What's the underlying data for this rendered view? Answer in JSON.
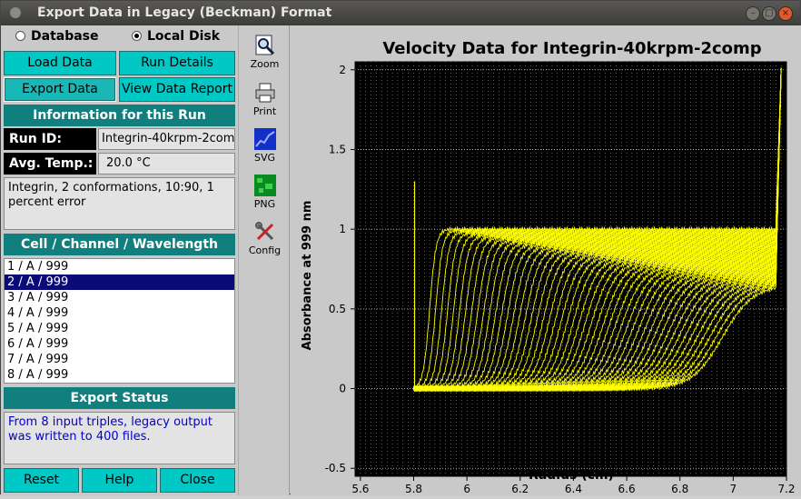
{
  "window": {
    "title": "Export Data in Legacy (Beckman) Format"
  },
  "source": {
    "options": [
      "Database",
      "Local Disk"
    ],
    "selected": "Local Disk"
  },
  "buttons": {
    "load_data": "Load Data",
    "run_details": "Run Details",
    "export_data": "Export Data",
    "view_report": "View Data Report",
    "reset": "Reset",
    "help": "Help",
    "close": "Close"
  },
  "run_info": {
    "header": "Information for this Run",
    "run_id_label": "Run ID:",
    "run_id": "Integrin-40krpm-2comp",
    "temp_label": "Avg. Temp.:",
    "temp": "20.0 °C",
    "description": "Integrin, 2 conformations, 10:90, 1 percent error"
  },
  "triples": {
    "header": "Cell / Channel / Wavelength",
    "items": [
      "1 / A / 999",
      "2 / A / 999",
      "3 / A / 999",
      "4 / A / 999",
      "5 / A / 999",
      "6 / A / 999",
      "7 / A / 999",
      "8 / A / 999"
    ],
    "selected_index": 1
  },
  "export_status": {
    "header": "Export Status",
    "message": "From 8 input triples, legacy output was written to 400 files."
  },
  "toolbar": {
    "items": [
      {
        "label": "Zoom",
        "icon": "zoom-icon"
      },
      {
        "label": "Print",
        "icon": "printer-icon"
      },
      {
        "label": "SVG",
        "icon": "svg-icon"
      },
      {
        "label": "PNG",
        "icon": "png-icon"
      },
      {
        "label": "Config",
        "icon": "config-icon"
      }
    ]
  },
  "colors": {
    "plot_bg": "#000000",
    "trace": "#ffff00",
    "accent": "#00c8c4",
    "banner": "#117f7e",
    "selected": "#0a0a78",
    "status_text": "#0000cc"
  },
  "chart_data": {
    "type": "line",
    "title": "Velocity Data for Integrin-40krpm-2comp",
    "xlabel": "Radius (cm)",
    "ylabel": "Absorbance at 999 nm",
    "xlim": [
      5.58,
      7.2
    ],
    "ylim": [
      -0.55,
      2.05
    ],
    "xticks": [
      5.6,
      5.8,
      6,
      6.2,
      6.4,
      6.6,
      6.8,
      7,
      7.2
    ],
    "xtick_labels": [
      "5.6",
      "5.8",
      "6",
      "6.2",
      "6.4",
      "6.6",
      "6.8",
      "7",
      "7.2"
    ],
    "yticks": [
      -0.5,
      0,
      0.5,
      1,
      1.5,
      2
    ],
    "ytick_labels": [
      "-0.5",
      "0",
      "0.5",
      "1",
      "1.5",
      "2"
    ],
    "grid": true,
    "meniscus": 5.8,
    "bottom": 7.18,
    "plateau": 1.0,
    "series_count": 50,
    "boundary_start": 5.86,
    "boundary_end": 6.96,
    "plateau_final": 0.65
  }
}
